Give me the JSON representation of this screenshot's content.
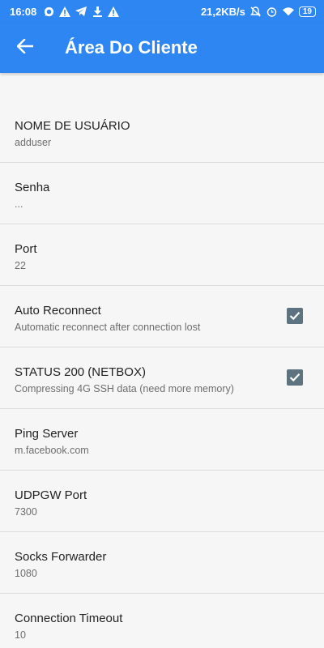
{
  "status_bar": {
    "time": "16:08",
    "network_speed": "21,2KB/s",
    "battery": "19",
    "left_icons": [
      "whatsapp-icon",
      "warning-icon",
      "telegram-icon",
      "download-icon",
      "warning-icon"
    ],
    "right_icons": [
      "mute-icon",
      "alarm-icon",
      "wifi-icon",
      "battery-icon"
    ]
  },
  "app_bar": {
    "title": "Área Do Cliente",
    "back_icon": "back-arrow-icon",
    "color": "#2d86f2"
  },
  "settings": [
    {
      "title": "NOME DE USUÁRIO",
      "subtitle": "adduser",
      "checkbox": null
    },
    {
      "title": "Senha",
      "subtitle": "...",
      "checkbox": null
    },
    {
      "title": "Port",
      "subtitle": "22",
      "checkbox": null
    },
    {
      "title": "Auto Reconnect",
      "subtitle": "Automatic reconnect after connection lost",
      "checkbox": true
    },
    {
      "title": "STATUS 200 (NETBOX)",
      "subtitle": "Compressing 4G SSH data (need more memory)",
      "checkbox": true
    },
    {
      "title": "Ping Server",
      "subtitle": "m.facebook.com",
      "checkbox": null
    },
    {
      "title": "UDPGW Port",
      "subtitle": "7300",
      "checkbox": null
    },
    {
      "title": "Socks Forwarder",
      "subtitle": "1080",
      "checkbox": null
    },
    {
      "title": "Connection Timeout",
      "subtitle": "10",
      "checkbox": null
    }
  ],
  "colors": {
    "primary": "#2d86f2",
    "checkbox": "#5d7380",
    "background": "#f6f6f6"
  }
}
